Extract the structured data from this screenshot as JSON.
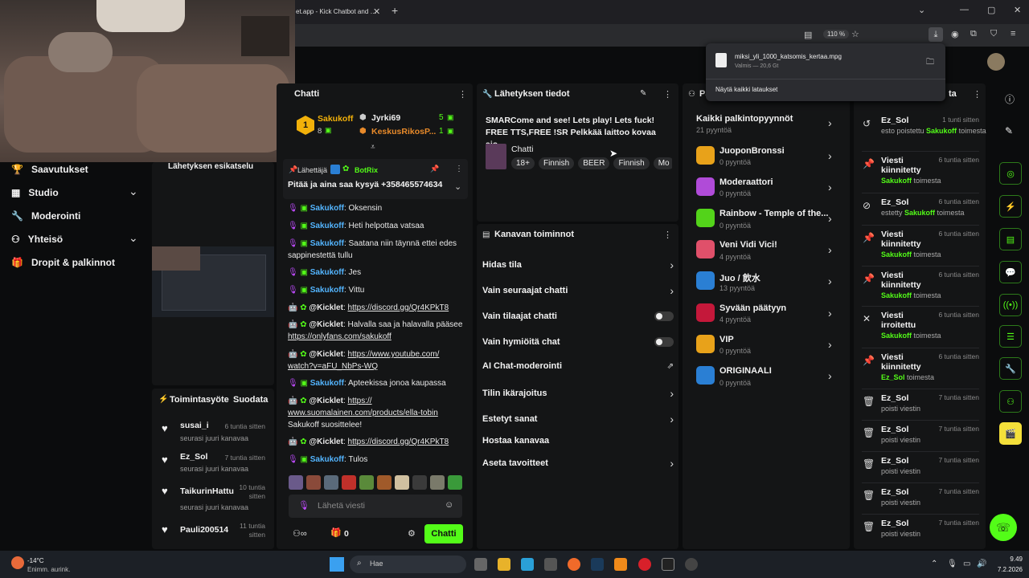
{
  "browser": {
    "tab_title": "et.app - Kick Chatbot and …",
    "zoom": "110 %",
    "download": {
      "file": "miksi_yli_1000_katsomis_kertaa.mpg",
      "status": "Valmis — 20,6 Gt",
      "show_all": "Näytä kaikki lataukset"
    }
  },
  "sidebar": {
    "items": [
      {
        "label": "Saavutukset"
      },
      {
        "label": "Studio"
      },
      {
        "label": "Moderointi"
      },
      {
        "label": "Yhteisö"
      },
      {
        "label": "Dropit & palkinnot"
      }
    ]
  },
  "preview": {
    "title": "Lähetyksen esikatselu"
  },
  "chat": {
    "title": "Chatti",
    "leaders": [
      {
        "rank": "1",
        "name": "Sakukoff",
        "count": "8"
      },
      {
        "name": "Jyrki69",
        "count": "5"
      },
      {
        "name": "KeskusRikosP...",
        "count": "1"
      }
    ],
    "pinned": {
      "label": "Lähettäjä",
      "user": "BotRix",
      "text": "Pitää ja aina saa kysyä +358465574634"
    },
    "messages": [
      {
        "user": "Sakukoff",
        "text": ": Oksensin"
      },
      {
        "user": "Sakukoff",
        "text": ": Heti helpottaa vatsaa"
      },
      {
        "user": "Sakukoff",
        "text": ": Saatana niin täynnä ettei edes sappinestettä tullu"
      },
      {
        "user": "Sakukoff",
        "text": ": Jes"
      },
      {
        "user": "Sakukoff",
        "text": ": Vittu"
      },
      {
        "user": "@Kicklet",
        "text": ": ",
        "link": "https://discord.gg/Qr4KPkT8"
      },
      {
        "user": "@Kicklet",
        "text": ": Halvalla saa ja halavalla pääsee ",
        "link": "https://onlyfans.com/sakukoff"
      },
      {
        "user": "@Kicklet",
        "text": ": ",
        "link": "https://www.youtube.com/ watch?v=aFU_NbPs-WQ"
      },
      {
        "user": "Sakukoff",
        "text": ": Apteekissa jonoa kaupassa"
      },
      {
        "user": "@Kicklet",
        "text": ": ",
        "link": "https:// www.suomalainen.com/products/ella-tobin",
        "after": " Sakukoff suosittelee!"
      },
      {
        "user": "@Kicklet",
        "text": ": ",
        "link": "https://discord.gg/Qr4KPkT8"
      },
      {
        "user": "Sakukoff",
        "text": ": Tulos"
      }
    ],
    "input_placeholder": "Lähetä viesti",
    "viewers": "0",
    "send": "Chatti"
  },
  "stream": {
    "title": "Lähetyksen tiedot",
    "stream_title": "SMARCome and see! Lets play! Lets fuck! FREE TTS,FREE !SR Pelkkää laittoo kovaa ajo...",
    "category": "Chatti",
    "tags": [
      "18+",
      "Finnish",
      "BEER",
      "Finnish",
      "Mo"
    ]
  },
  "channel": {
    "title": "Kanavan toiminnot",
    "items": [
      {
        "label": "Hidas tila"
      },
      {
        "label": "Vain seuraajat chatti"
      },
      {
        "label": "Vain tilaajat chatti"
      },
      {
        "label": "Vain hymiöitä chat"
      },
      {
        "label": "AI Chat-moderointi"
      },
      {
        "label": "Tilin ikärajoitus"
      },
      {
        "label": "Estetyt sanat"
      },
      {
        "label": "Hostaa kanavaa"
      },
      {
        "label": "Aseta tavoitteet"
      }
    ]
  },
  "rewards": {
    "title": "Pa",
    "all": "Kaikki palkintopyynnöt",
    "all_count": "21 pyyntöä",
    "items": [
      {
        "name": "JuoponBronssi",
        "count": "0 pyyntöä",
        "color": "#e8a21a"
      },
      {
        "name": "Moderaattori",
        "count": "0 pyyntöä",
        "color": "#b04bd8"
      },
      {
        "name": "Rainbow - Temple of the...",
        "count": "0 pyyntöä",
        "color": "#53d31a"
      },
      {
        "name": "Veni Vidi Vici!",
        "count": "4 pyyntöä",
        "color": "#e0506a"
      },
      {
        "name": "Juo / 飲水",
        "count": "13 pyyntöä",
        "color": "#2a7fd4"
      },
      {
        "name": "Syvään päätyyn",
        "count": "4 pyyntöä",
        "color": "#c4183a"
      },
      {
        "name": "VIP",
        "count": "0 pyyntöä",
        "color": "#e8a21a"
      },
      {
        "name": "ORIGINAALI",
        "count": "0 pyyntöä",
        "color": "#2a7fd4"
      }
    ]
  },
  "activity": {
    "title": "ta",
    "items": [
      {
        "icon": "↺",
        "title": "Ez_Sol",
        "time": "1 tunti sitten",
        "sub": "esto poistettu ",
        "by": "Sakukoff",
        "tail": " toimesta"
      },
      {
        "icon": "📌",
        "title": "Viesti kiinnitetty",
        "time": "6 tuntia sitten",
        "sub": "",
        "by": "Sakukoff",
        "tail": " toimesta"
      },
      {
        "icon": "⊘",
        "title": "Ez_Sol",
        "time": "6 tuntia sitten",
        "sub": "estetty ",
        "by": "Sakukoff",
        "tail": " toimesta"
      },
      {
        "icon": "📌",
        "title": "Viesti kiinnitetty",
        "time": "6 tuntia sitten",
        "sub": "",
        "by": "Sakukoff",
        "tail": " toimesta"
      },
      {
        "icon": "📌",
        "title": "Viesti kiinnitetty",
        "time": "6 tuntia sitten",
        "sub": "",
        "by": "Sakukoff",
        "tail": " toimesta"
      },
      {
        "icon": "✕",
        "title": "Viesti irroitettu",
        "time": "6 tuntia sitten",
        "sub": "",
        "by": "Sakukoff",
        "tail": " toimesta"
      },
      {
        "icon": "📌",
        "title": "Viesti kiinnitetty",
        "time": "6 tuntia sitten",
        "sub": "",
        "by": "Ez_Sol",
        "tail": " toimesta"
      },
      {
        "icon": "🗑",
        "title": "Ez_Sol",
        "time": "7 tuntia sitten",
        "sub": "poisti viestin",
        "by": "",
        "tail": ""
      },
      {
        "icon": "🗑",
        "title": "Ez_Sol",
        "time": "7 tuntia sitten",
        "sub": "poisti viestin",
        "by": "",
        "tail": ""
      },
      {
        "icon": "🗑",
        "title": "Ez_Sol",
        "time": "7 tuntia sitten",
        "sub": "poisti viestin",
        "by": "",
        "tail": ""
      },
      {
        "icon": "🗑",
        "title": "Ez_Sol",
        "time": "7 tuntia sitten",
        "sub": "poisti viestin",
        "by": "",
        "tail": ""
      },
      {
        "icon": "🗑",
        "title": "Ez_Sol",
        "time": "7 tuntia sitten",
        "sub": "poisti viestin",
        "by": "",
        "tail": ""
      }
    ]
  },
  "feed": {
    "title": "Toimintasyöte",
    "follow": "Suodata",
    "items": [
      {
        "name": "susai_i",
        "time": "6 tuntia sitten",
        "sub": "seurasi juuri kanavaa"
      },
      {
        "name": "Ez_Sol",
        "time": "7 tuntia sitten",
        "sub": "seurasi juuri kanavaa"
      },
      {
        "name": "TaikurinHattu",
        "time": "10 tuntia sitten",
        "sub": "seurasi juuri kanavaa"
      },
      {
        "name": "Pauli200514",
        "time": "11 tuntia sitten",
        "sub": "seurasi juuri kanavaa"
      }
    ]
  },
  "taskbar": {
    "weather_temp": "-14°C",
    "weather_desc": "Enimm. aurink.",
    "search": "Hae",
    "time": "9.49",
    "date": "7.2.2026"
  }
}
